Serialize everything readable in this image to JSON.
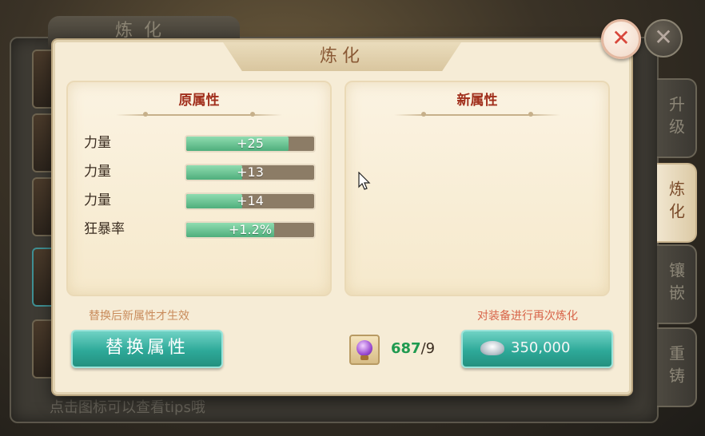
{
  "background": {
    "window_title": "炼化",
    "hint": "点击图标可以查看tips哦",
    "close_symbol": "✕",
    "side_tabs": [
      {
        "label": "升级",
        "active": false
      },
      {
        "label": "炼化",
        "active": true
      },
      {
        "label": "镶嵌",
        "active": false
      },
      {
        "label": "重铸",
        "active": false
      }
    ]
  },
  "dialog": {
    "title": "炼化",
    "close_symbol": "✕",
    "original_panel": {
      "title": "原属性",
      "stats": [
        {
          "name": "力量",
          "value": "+25",
          "fill": 0.8
        },
        {
          "name": "力量",
          "value": "+13",
          "fill": 0.44
        },
        {
          "name": "力量",
          "value": "+14",
          "fill": 0.44
        },
        {
          "name": "狂暴率",
          "value": "+1.2%",
          "fill": 0.69
        }
      ]
    },
    "new_panel": {
      "title": "新属性",
      "stats": []
    },
    "hint_left": "替换后新属性才生效",
    "hint_right": "对装备进行再次炼化",
    "replace_button": "替换属性",
    "material": {
      "icon": "purple-gem-icon",
      "have": "687",
      "need": "/9"
    },
    "refine_button": {
      "icon": "silver-ingot-icon",
      "price": "350,000"
    }
  },
  "colors": {
    "accent_teal": "#2ea999",
    "title_red": "#a12f1c",
    "bar_green": "#4fae7c",
    "count_green": "#1f9a50"
  }
}
